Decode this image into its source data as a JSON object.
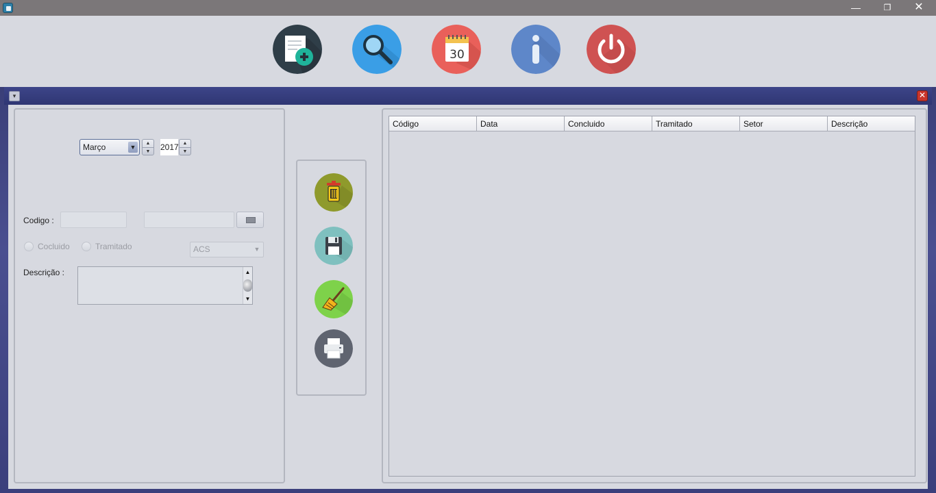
{
  "window": {
    "minimize_glyph": "—",
    "maximize_glyph": "❐",
    "close_glyph": "✕"
  },
  "toolbar": {
    "buttons": [
      {
        "icon": "new-document-icon",
        "color": "#2f3e48"
      },
      {
        "icon": "search-icon",
        "color": "#3a9ee6"
      },
      {
        "icon": "calendar-icon",
        "color": "#e9605a",
        "text": "30"
      },
      {
        "icon": "info-icon",
        "color": "#5e87c9"
      },
      {
        "icon": "power-icon",
        "color": "#cf5252"
      }
    ]
  },
  "internal_frame": {
    "menu_glyph": "▾",
    "close_glyph": "✕"
  },
  "form": {
    "month": "Março",
    "month_arrow": "▼",
    "spin_up": "▲",
    "spin_down": "▼",
    "year": "2017",
    "codigo_label": "Codigo :",
    "codigo_value": "",
    "data_value": "",
    "concluido_label": "Cocluido",
    "tramitado_label": "Tramitado",
    "setor_value": "ACS",
    "setor_arrow": "▼",
    "descricao_label": "Descrição :",
    "descricao_value": "",
    "scroll_up": "▲",
    "scroll_down": "▼"
  },
  "actions": [
    {
      "icon": "trash-icon",
      "color": "#8f9a2c"
    },
    {
      "icon": "floppy-save-icon",
      "color": "#7fc0bf"
    },
    {
      "icon": "broom-icon",
      "color": "#7ed24a"
    },
    {
      "icon": "printer-icon",
      "color": "#5f6470"
    }
  ],
  "table": {
    "columns": [
      "Código",
      "Data",
      "Concluido",
      "Tramitado",
      "Setor",
      "Descrição"
    ],
    "rows": []
  }
}
